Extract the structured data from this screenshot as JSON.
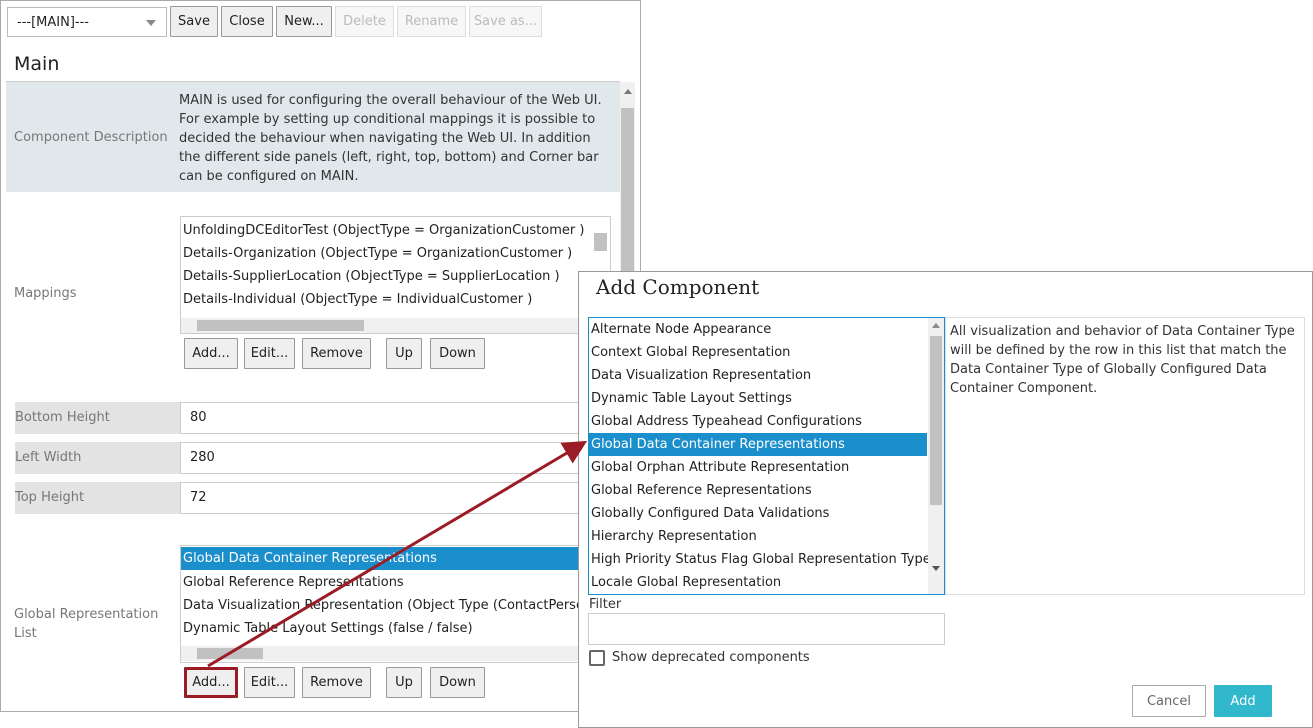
{
  "toolbar": {
    "select_value": "---[MAIN]---",
    "save": "Save",
    "close": "Close",
    "new": "New...",
    "delete": "Delete",
    "rename": "Rename",
    "save_as": "Save as..."
  },
  "main": {
    "title": "Main",
    "description_label": "Component Description",
    "description": "MAIN is used for configuring the overall behaviour of the Web UI. For example by setting up conditional mappings it is possible to decided the behaviour when navigating the Web UI. In addition the different side panels (left, right, top, bottom) and Corner bar can be configured on MAIN.",
    "mappings_label": "Mappings",
    "mappings": [
      "UnfoldingDCEditorTest (ObjectType = OrganizationCustomer )",
      "Details-Organization (ObjectType = OrganizationCustomer )",
      "Details-SupplierLocation (ObjectType = SupplierLocation )",
      "Details-Individual (ObjectType = IndividualCustomer )"
    ],
    "buttons": {
      "add": "Add...",
      "edit": "Edit...",
      "remove": "Remove",
      "up": "Up",
      "down": "Down"
    },
    "fields": [
      {
        "label": "Bottom Height",
        "value": "80"
      },
      {
        "label": "Left Width",
        "value": "280"
      },
      {
        "label": "Top Height",
        "value": "72"
      }
    ],
    "grl_label": "Global Representation List",
    "grl": [
      "Global Data Container Representations",
      "Global Reference Representations",
      "Data Visualization Representation (Object Type (ContactPerson / ",
      "Dynamic Table Layout Settings (false / false)"
    ]
  },
  "dialog": {
    "title": "Add Component",
    "items": [
      "Alternate Node Appearance",
      "Context Global Representation",
      "Data Visualization Representation",
      "Dynamic Table Layout Settings",
      "Global Address Typeahead Configurations",
      "Global Data Container Representations",
      "Global Orphan Attribute Representation",
      "Global Reference Representations",
      "Globally Configured Data Validations",
      "Hierarchy Representation",
      "High Priority Status Flag Global Representation Type",
      "Locale Global Representation"
    ],
    "selected_index": 5,
    "description": "All visualization and behavior of Data Container Type will be defined by the row in this list that match the Data Container Type of Globally Configured Data Container Component.",
    "filter_label": "Filter",
    "filter_value": "",
    "deprecated_label": "Show deprecated components",
    "cancel": "Cancel",
    "add": "Add"
  },
  "colors": {
    "accent": "#1a8fcb",
    "add_button": "#31b8cc",
    "annotation": "#9b1c24"
  }
}
